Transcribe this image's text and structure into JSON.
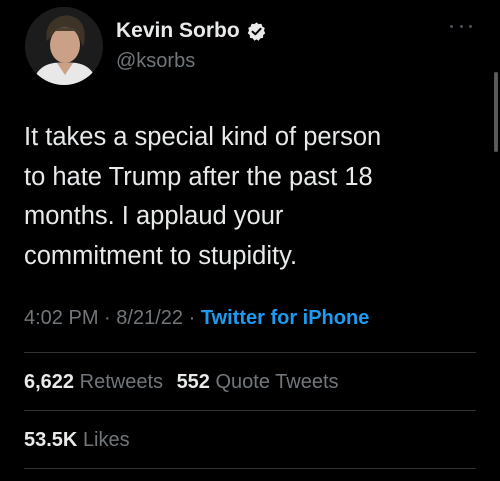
{
  "author": {
    "display_name": "Kevin Sorbo",
    "handle": "@ksorbs",
    "verified_icon": "verified-badge-icon"
  },
  "tweet": {
    "text_lines": [
      "It takes a special kind of person",
      "to hate Trump after the past 18",
      "months. I applaud your",
      "commitment to stupidity."
    ]
  },
  "meta": {
    "time": "4:02 PM",
    "separator": "·",
    "date": "8/21/22",
    "source": "Twitter for iPhone"
  },
  "stats": {
    "retweets_count": "6,622",
    "retweets_label": "Retweets",
    "quote_tweets_count": "552",
    "quote_tweets_label": "Quote Tweets",
    "likes_count": "53.5K",
    "likes_label": "Likes"
  },
  "colors": {
    "background": "#000000",
    "text": "#e7e9ea",
    "secondary": "#71767b",
    "link": "#1d9bf0",
    "divider": "#2f3336"
  }
}
